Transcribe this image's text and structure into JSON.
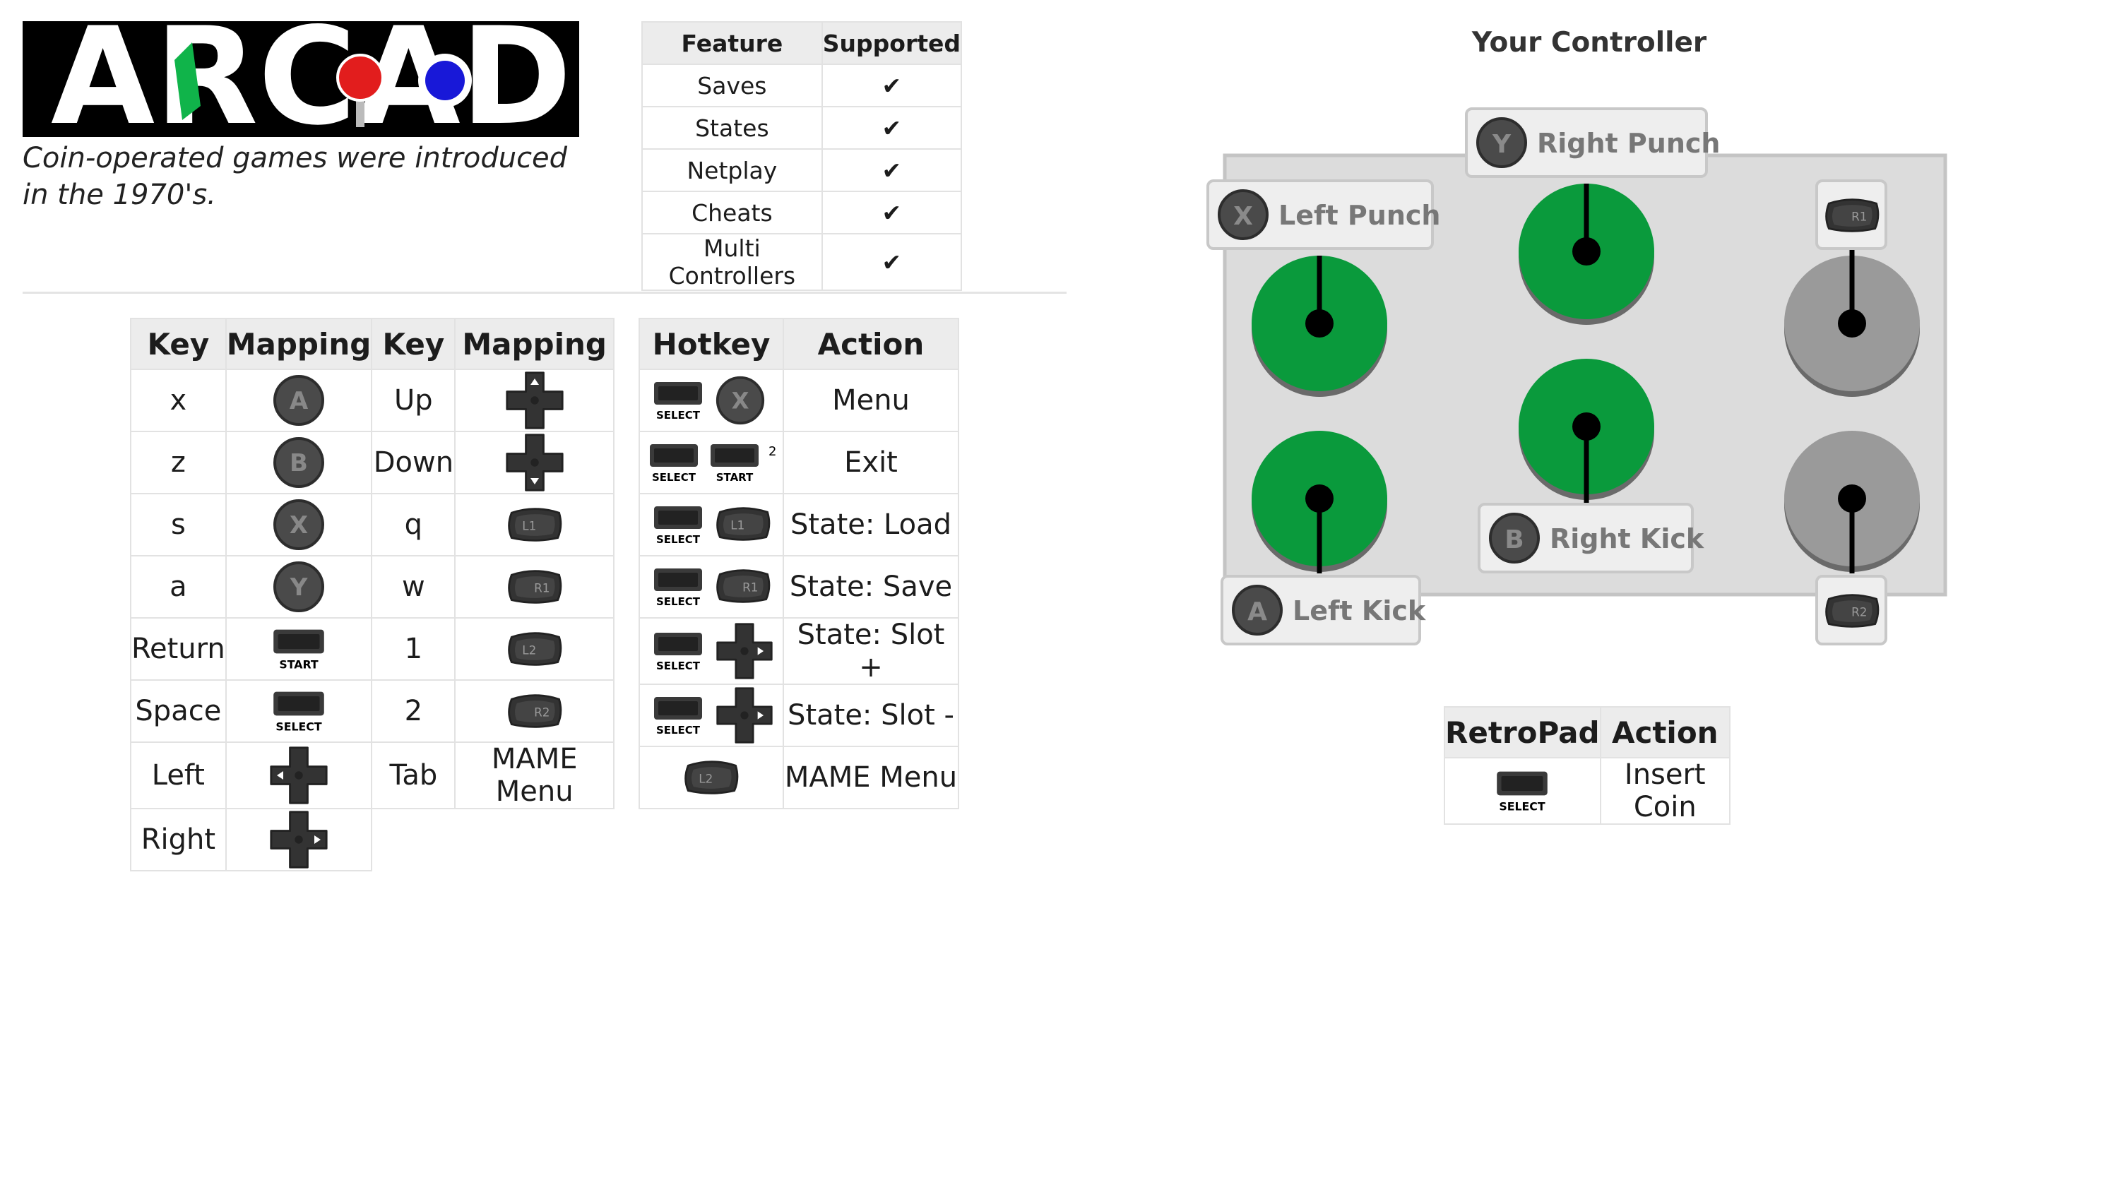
{
  "header": {
    "logo_text": "ARCADE",
    "subtitle": "Coin-operated games were introduced in the 1970's."
  },
  "features": {
    "headers": [
      "Feature",
      "Supported"
    ],
    "rows": [
      [
        "Saves",
        "✔"
      ],
      [
        "States",
        "✔"
      ],
      [
        "Netplay",
        "✔"
      ],
      [
        "Cheats",
        "✔"
      ],
      [
        "Multi Controllers",
        "✔"
      ]
    ]
  },
  "key_mappings": {
    "headers": [
      "Key",
      "Mapping",
      "Key",
      "Mapping"
    ],
    "rows": [
      {
        "key1": "x",
        "map1": "A-button-icon",
        "key2": "Up",
        "map2": "dpad-up-icon"
      },
      {
        "key1": "z",
        "map1": "B-button-icon",
        "key2": "Down",
        "map2": "dpad-down-icon"
      },
      {
        "key1": "s",
        "map1": "X-button-icon",
        "key2": "q",
        "map2": "L1-bumper-icon"
      },
      {
        "key1": "a",
        "map1": "Y-button-icon",
        "key2": "w",
        "map2": "R1-bumper-icon"
      },
      {
        "key1": "Return",
        "map1": "start-button-icon",
        "key2": "1",
        "map2": "L2-trigger-icon"
      },
      {
        "key1": "Space",
        "map1": "select-button-icon",
        "key2": "2",
        "map2": "R2-trigger-icon"
      },
      {
        "key1": "Left",
        "map1": "dpad-left-icon",
        "key2": "Tab",
        "map2": "MAME Menu"
      },
      {
        "key1": "Right",
        "map1": "dpad-right-icon"
      }
    ]
  },
  "hotkeys": {
    "headers": [
      "Hotkey",
      "Action"
    ],
    "rows": [
      {
        "combo": "select + X",
        "action": "Menu"
      },
      {
        "combo": "select + start (2)",
        "action": "Exit"
      },
      {
        "combo": "select + L1",
        "action": "State: Load"
      },
      {
        "combo": "select + R1",
        "action": "State: Save"
      },
      {
        "combo": "select + dpad-right",
        "action": "State: Slot +"
      },
      {
        "combo": "select + dpad-left",
        "action": "State: Slot -"
      },
      {
        "combo": "L2",
        "action": "MAME Menu"
      }
    ]
  },
  "labels": {
    "select": "SELECT",
    "start": "START",
    "two": "2",
    "L1": "L1",
    "R1": "R1",
    "L2": "L2",
    "R2": "R2"
  },
  "buttons": {
    "A": "A",
    "B": "B",
    "X": "X",
    "Y": "Y"
  },
  "controller": {
    "title": "Your Controller",
    "callouts": {
      "left_punch": {
        "btn": "X",
        "label": "Left Punch"
      },
      "right_punch": {
        "btn": "Y",
        "label": "Right Punch"
      },
      "left_kick": {
        "btn": "A",
        "label": "Left Kick"
      },
      "right_kick": {
        "btn": "B",
        "label": "Right Kick"
      },
      "r1": "R1",
      "r2": "R2"
    },
    "colors": {
      "active": "#0a9a3c",
      "inactive": "#9a9a9a",
      "panel": "#dcdcdc"
    }
  },
  "retropad": {
    "headers": [
      "RetroPad",
      "Action"
    ],
    "rows": [
      {
        "pad": "SELECT",
        "action": "Insert Coin"
      }
    ]
  }
}
